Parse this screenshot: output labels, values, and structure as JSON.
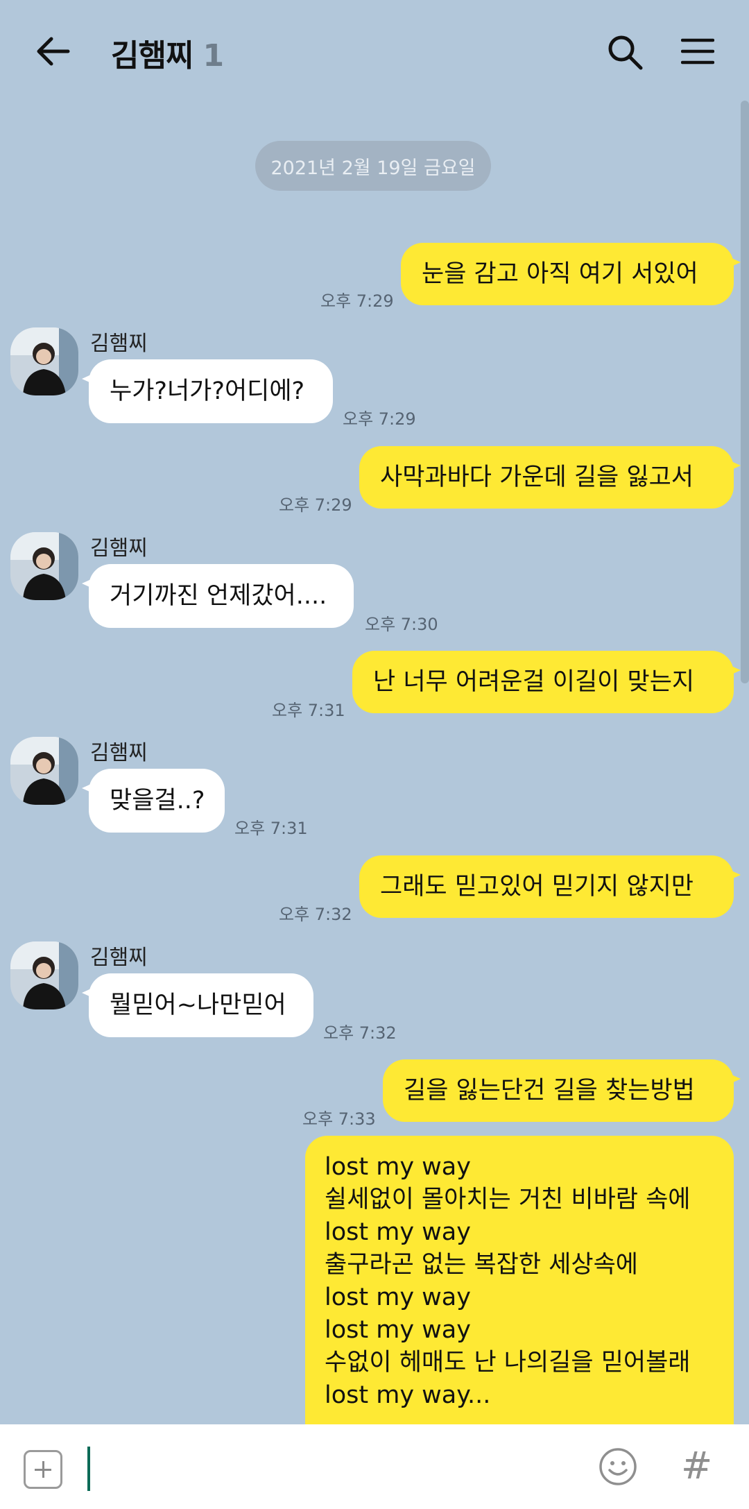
{
  "header": {
    "title": "김햄찌",
    "member_count": "1",
    "back_icon": "back-arrow-icon",
    "search_icon": "search-icon",
    "menu_icon": "menu-icon"
  },
  "date_divider": "2021년 2월 19일 금요일",
  "messages": [
    {
      "from": "me",
      "text": "눈을 감고 아직 여기 서있어",
      "time": "오후 7:29"
    },
    {
      "from": "other",
      "sender": "김햄찌",
      "text": "누가?너가?어디에?",
      "time": "오후 7:29"
    },
    {
      "from": "me",
      "text": "사막과바다 가운데 길을 잃고서",
      "time": "오후 7:29"
    },
    {
      "from": "other",
      "sender": "김햄찌",
      "text": "거기까진 언제갔어....",
      "time": "오후 7:30"
    },
    {
      "from": "me",
      "text": "난 너무 어려운걸 이길이 맞는지",
      "time": "오후 7:31"
    },
    {
      "from": "other",
      "sender": "김햄찌",
      "text": "맞을걸..?",
      "time": "오후 7:31"
    },
    {
      "from": "me",
      "text": "그래도 믿고있어 믿기지 않지만",
      "time": "오후 7:32"
    },
    {
      "from": "other",
      "sender": "김햄찌",
      "text": "뭘믿어~나만믿어",
      "time": "오후 7:32"
    },
    {
      "from": "me",
      "text": "길을 잃는단건 길을 찾는방법",
      "time": "오후 7:33"
    }
  ],
  "long_message": {
    "lines": [
      "lost my way",
      "쉴세없이 몰아치는 거친 비바람 속에",
      "lost my way",
      "출구라곤 없는 복잡한 세상속에",
      "lost my way",
      "lost my way",
      "수없이 헤매도 난 나의길을 믿어볼래",
      "lost my way..."
    ]
  },
  "input_bar": {
    "plus_icon": "plus-icon",
    "emoji_icon": "emoji-icon",
    "hash_label": "#",
    "input_value": ""
  }
}
